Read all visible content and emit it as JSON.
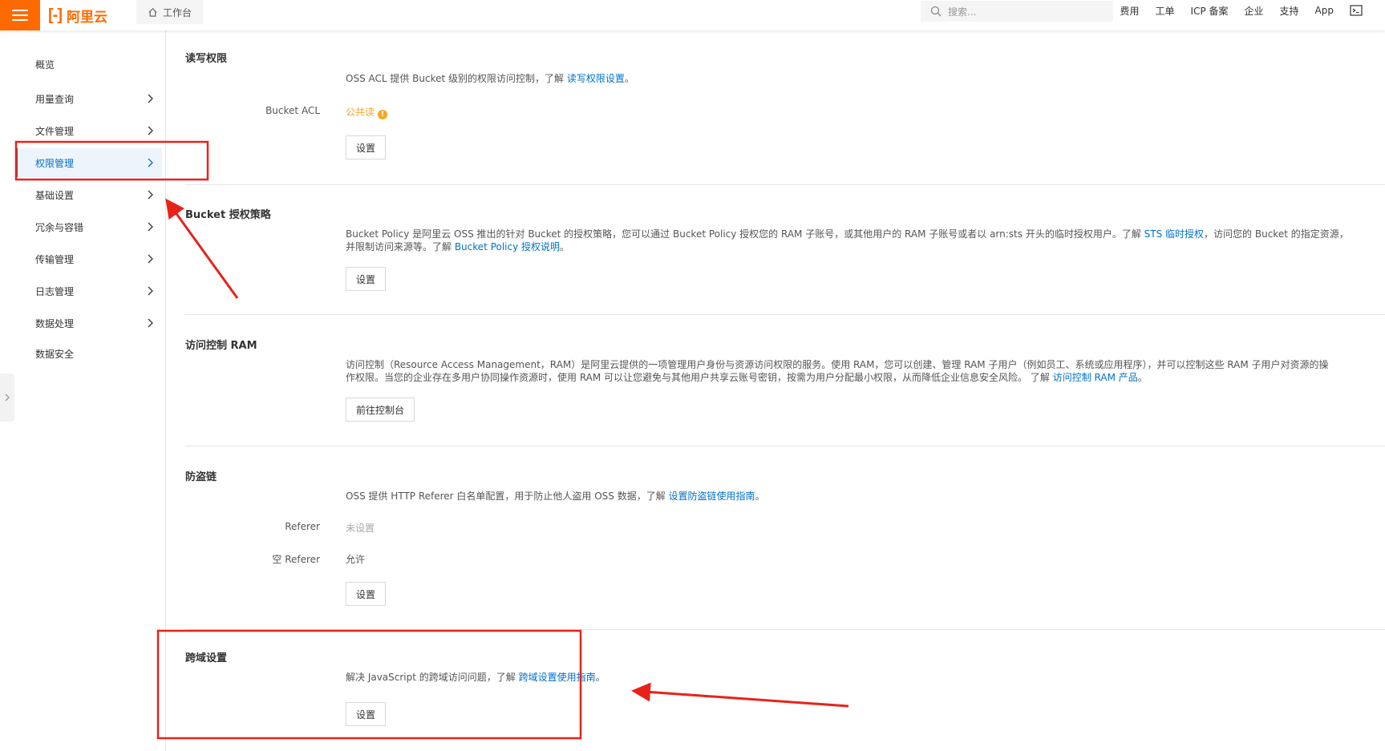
{
  "topbar": {
    "logo_text": "阿里云",
    "workbench_label": "工作台",
    "search_placeholder": "搜索...",
    "nav": [
      "费用",
      "工单",
      "ICP 备案",
      "企业",
      "支持",
      "App"
    ]
  },
  "sidebar": {
    "items": [
      {
        "label": "概览",
        "chevron": false
      },
      {
        "label": "用量查询",
        "chevron": true
      },
      {
        "label": "文件管理",
        "chevron": true
      },
      {
        "label": "权限管理",
        "chevron": true,
        "active": true
      },
      {
        "label": "基础设置",
        "chevron": true
      },
      {
        "label": "冗余与容错",
        "chevron": true
      },
      {
        "label": "传输管理",
        "chevron": true
      },
      {
        "label": "日志管理",
        "chevron": true
      },
      {
        "label": "数据处理",
        "chevron": true
      },
      {
        "label": "数据安全",
        "chevron": false
      }
    ]
  },
  "sections": {
    "acl": {
      "title": "读写权限",
      "desc_prefix": "OSS ACL 提供 Bucket 级别的权限访问控制，了解 ",
      "desc_link": "读写权限设置",
      "desc_suffix": "。",
      "field_label": "Bucket ACL",
      "field_value": "公共读",
      "button": "设置"
    },
    "policy": {
      "title": "Bucket 授权策略",
      "desc_p1": "Bucket Policy 是阿里云 OSS 推出的针对 Bucket 的授权策略，您可以通过 Bucket Policy 授权您的 RAM 子账号，或其他用户的 RAM 子账号或者以 arn:sts 开头的临时授权用户。了解 ",
      "desc_link1": "STS 临时授权",
      "desc_p2": "，访问您的 Bucket 的指定资源，",
      "desc_p3": "并限制访问来源等。了解 ",
      "desc_link2": "Bucket Policy 授权说明",
      "desc_suffix": "。",
      "button": "设置"
    },
    "ram": {
      "title": "访问控制 RAM",
      "desc_p1": "访问控制（Resource Access Management，RAM）是阿里云提供的一项管理用户身份与资源访问权限的服务。使用 RAM，您可以创建、管理 RAM 子用户（例如员工、系统或应用程序），并可以控制这些 RAM 子用户对资源的操",
      "desc_p2": "作权限。当您的企业存在多用户协同操作资源时，使用 RAM 可以让您避免与其他用户共享云账号密钥，按需为用户分配最小权限，从而降低企业信息安全风险。 了解 ",
      "desc_link": "访问控制 RAM 产品",
      "desc_suffix": "。",
      "button": "前往控制台"
    },
    "referer": {
      "title": "防盗链",
      "desc_prefix": "OSS 提供 HTTP Referer 白名单配置，用于防止他人盗用 OSS 数据，了解 ",
      "desc_link": "设置防盗链使用指南",
      "desc_suffix": "。",
      "field1_label": "Referer",
      "field1_value": "未设置",
      "field2_label": "空 Referer",
      "field2_value": "允许",
      "button": "设置"
    },
    "cors": {
      "title": "跨域设置",
      "desc_prefix": "解决 JavaScript 的跨域访问问题，了解 ",
      "desc_link": "跨域设置使用指南",
      "desc_suffix": "。",
      "button": "设置"
    }
  },
  "colors": {
    "brand": "#ff6a00",
    "link": "#0070cc",
    "warning": "#f5a623",
    "annotation": "#e8221b"
  }
}
